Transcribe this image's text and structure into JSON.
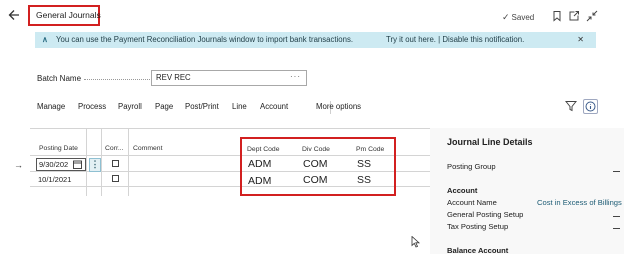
{
  "header": {
    "back_icon": "arrow-left-icon",
    "title": "General Journals",
    "saved": "Saved",
    "icons": [
      "bookmark-icon",
      "open-in-new-icon",
      "collapse-icon"
    ]
  },
  "notification": {
    "message": "You can use the Payment Reconciliation Journals window to import bank transactions.",
    "actions": "Try it out here. | Disable this notification."
  },
  "batch": {
    "label": "Batch Name",
    "value": "REV REC",
    "more": "···"
  },
  "actionbar": {
    "items": [
      "Manage",
      "Process",
      "Payroll",
      "Page",
      "Post/Print",
      "Line",
      "Account"
    ],
    "more": "More options"
  },
  "grid": {
    "columns": [
      "Posting Date",
      "Corr...",
      "Comment",
      "Dept Code",
      "Div Code",
      "Pm Code"
    ],
    "rows": [
      {
        "posting_date": "9/30/202",
        "dept": "ADM",
        "div": "COM",
        "pm": "SS"
      },
      {
        "posting_date": "10/1/2021",
        "dept": "ADM",
        "div": "COM",
        "pm": "SS"
      }
    ]
  },
  "details": {
    "title": "Journal Line Details",
    "posting_group_label": "Posting Group",
    "account_header": "Account",
    "account_name_label": "Account Name",
    "account_name_value": "Cost in Excess of Billings",
    "gen_posting_setup_label": "General Posting Setup",
    "tax_posting_setup_label": "Tax Posting Setup",
    "balance_account_header": "Balance Account"
  },
  "colors": {
    "notification_bg": "#cdeaf2",
    "highlight": "#d22020",
    "link": "#1c5b74"
  }
}
